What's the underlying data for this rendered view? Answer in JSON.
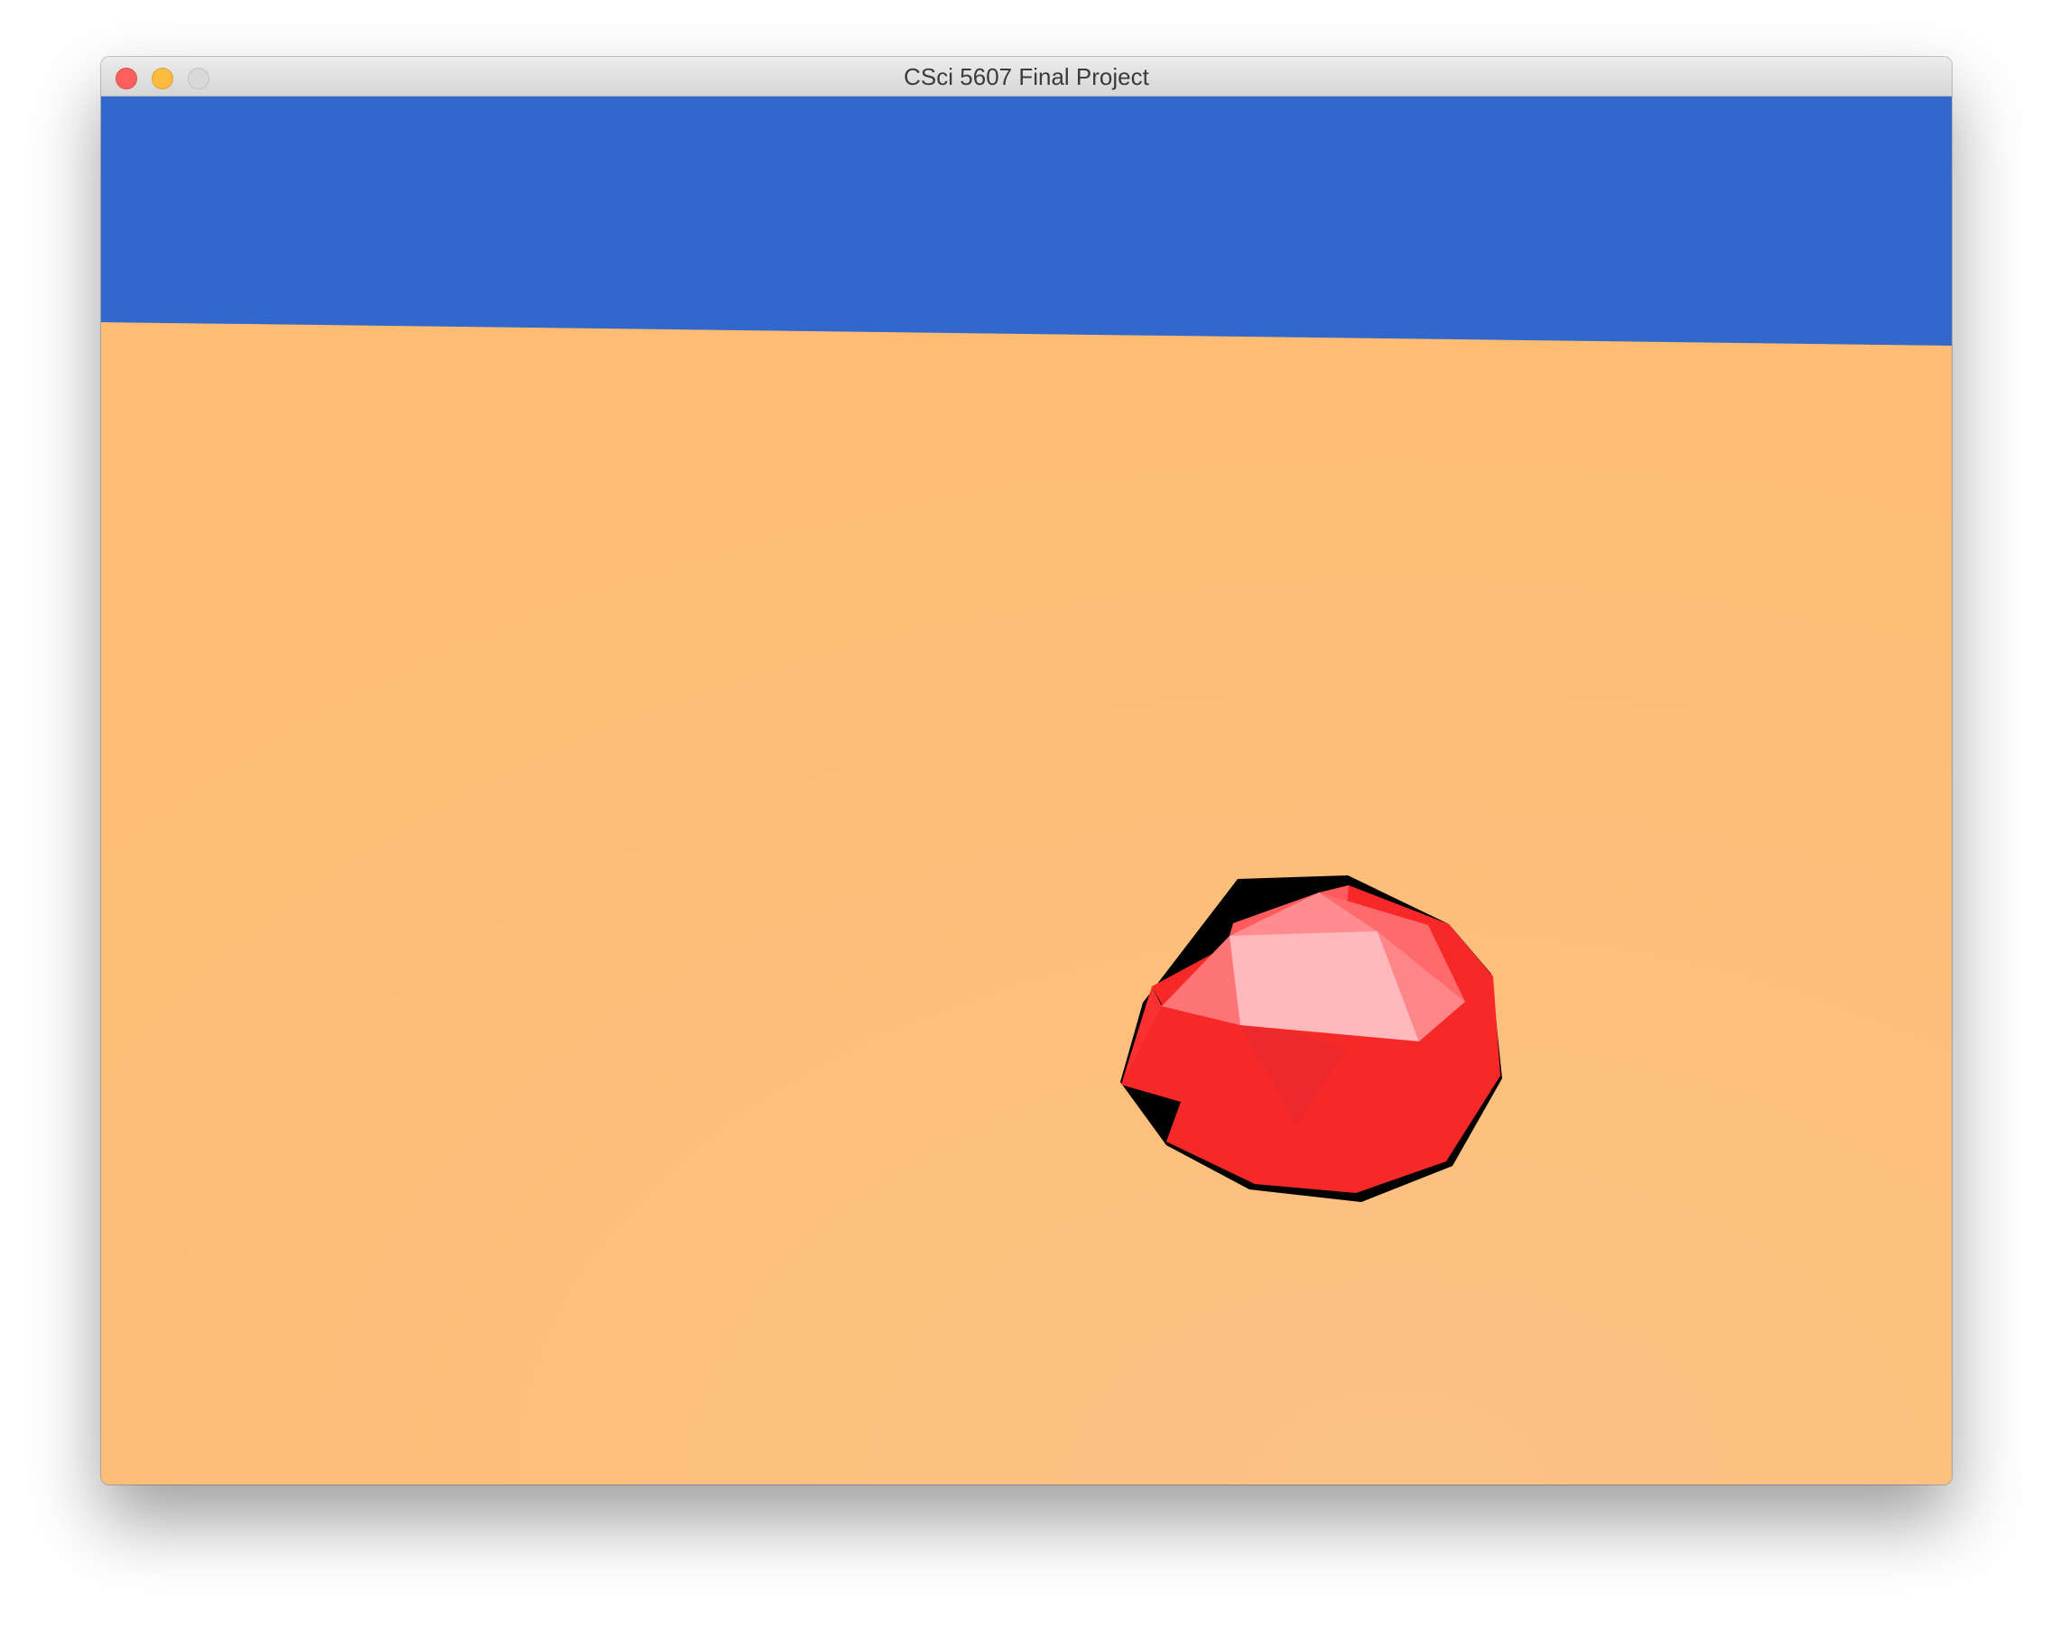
{
  "window": {
    "title": "CSci 5607 Final Project",
    "buttons": {
      "close": "close-icon",
      "minimize": "minimize-icon",
      "zoom": "zoom-icon"
    }
  },
  "scene": {
    "sky_color": "#3267cc",
    "ground_color": "#fcbd75",
    "ball_color": "#f72828",
    "ball_highlight_color": "#ffb8bc",
    "ball_shadow_color": "#000000"
  }
}
